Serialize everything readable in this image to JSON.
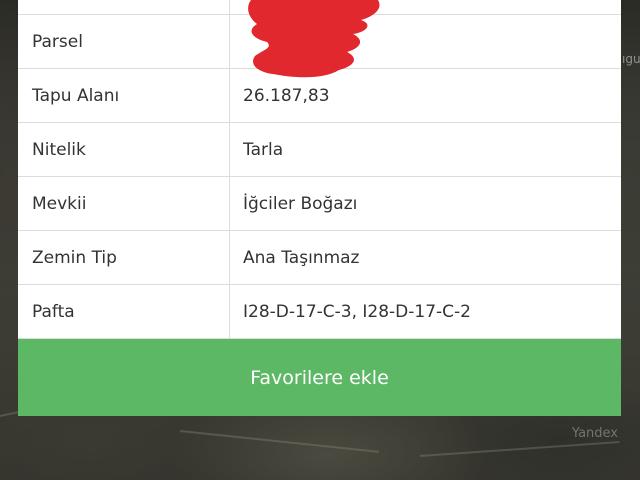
{
  "map": {
    "labels": [
      "ıgu"
    ],
    "watermark": "Yandex"
  },
  "details": {
    "rows": [
      {
        "label": "Parsel",
        "value": ""
      },
      {
        "label": "Tapu Alanı",
        "value": "26.187,83"
      },
      {
        "label": "Nitelik",
        "value": "Tarla"
      },
      {
        "label": "Mevkii",
        "value": "İğciler Boğazı"
      },
      {
        "label": "Zemin Tip",
        "value": "Ana Taşınmaz"
      },
      {
        "label": "Pafta",
        "value": "I28-D-17-C-3, I28-D-17-C-2"
      }
    ],
    "redaction_color": "#e0282e"
  },
  "actions": {
    "favorite_label": "Favorilere ekle",
    "favorite_color": "#5cb865"
  }
}
